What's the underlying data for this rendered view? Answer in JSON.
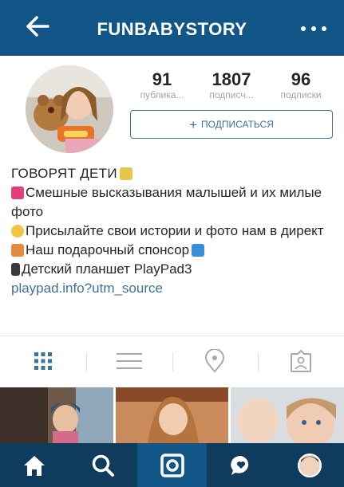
{
  "header": {
    "username": "FUNBABYSTORY"
  },
  "stats": {
    "posts": {
      "value": "91",
      "label": "публика..."
    },
    "followers": {
      "value": "1807",
      "label": "подписч..."
    },
    "following": {
      "value": "96",
      "label": "подписки"
    }
  },
  "follow_button": {
    "plus": "+",
    "label": "ПОДПИСАТЬСЯ"
  },
  "bio": {
    "name": "ГОВОРЯТ ДЕТИ",
    "line1": "Смешные высказывания малышей и их милые фото",
    "line2": "Присылайте свои истории и фото нам в директ",
    "line3": "Наш подарочный спонсор",
    "line4": "Детский планшет PlayPad3",
    "link": "playpad.info?utm_source"
  },
  "colors": {
    "header_bg": "#125688",
    "link": "#3f729b",
    "bottom_nav_bg": "#0f3b5c",
    "grid_icon_active": "#3f729b"
  },
  "icons": {
    "back": "arrow-left-icon",
    "more": "ellipsis-icon",
    "tab_grid": "grid-icon",
    "tab_list": "list-icon",
    "tab_location": "location-pin-icon",
    "tab_tagged": "tagged-person-icon",
    "nav_home": "home-icon",
    "nav_search": "search-icon",
    "nav_camera": "camera-icon",
    "nav_activity": "activity-bubble-icon",
    "nav_profile": "profile-avatar-icon"
  }
}
